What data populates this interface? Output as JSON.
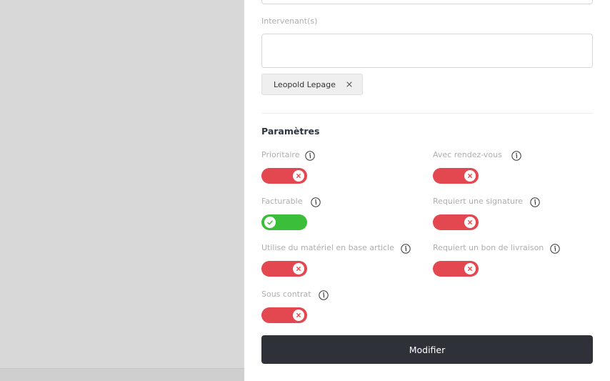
{
  "intervenants": {
    "label": "Intervenant(s)",
    "input_value": "",
    "chips": [
      {
        "label": "Leopold Lepage"
      }
    ]
  },
  "parametres": {
    "title": "Paramètres",
    "settings": [
      {
        "label": "Prioritaire",
        "enabled": false
      },
      {
        "label": "Avec rendez-vous",
        "enabled": false
      },
      {
        "label": "Facturable",
        "enabled": true
      },
      {
        "label": "Requiert une signature",
        "enabled": false
      },
      {
        "label": "Utilise du matériel en base article",
        "enabled": false
      },
      {
        "label": "Requiert un bon de livraison",
        "enabled": false
      },
      {
        "label": "Sous contrat",
        "enabled": false
      }
    ]
  },
  "submit_label": "Modifier",
  "colors": {
    "toggle_off": "#e3474f",
    "toggle_on": "#3bbf3b",
    "button_bg": "#2e3138"
  }
}
